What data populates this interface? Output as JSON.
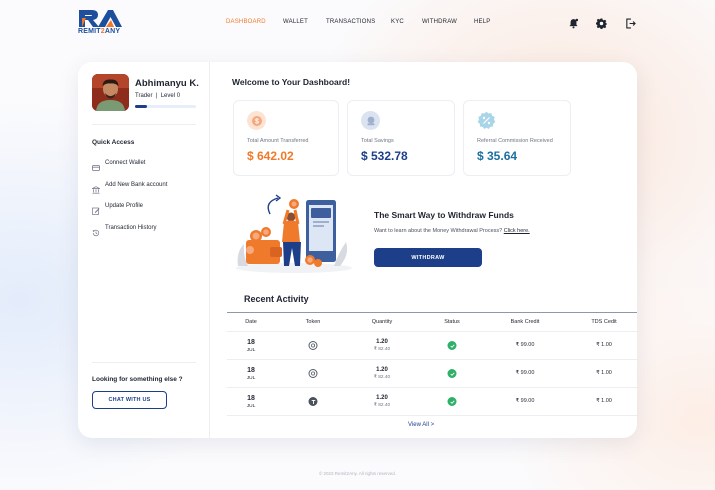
{
  "brand": {
    "logo_text_a": "REMIT",
    "logo_text_b": "2",
    "logo_text_c": "ANY",
    "logo_icon": "ra-logo-icon"
  },
  "nav": {
    "items": [
      {
        "label": "DASHBOARD",
        "active": true
      },
      {
        "label": "WALLET",
        "active": false
      },
      {
        "label": "TRANSACTIONS",
        "active": false
      },
      {
        "label": "KYC",
        "active": false
      },
      {
        "label": "WITHDRAW",
        "active": false
      },
      {
        "label": "HELP",
        "active": false
      }
    ],
    "icons": [
      "bell-icon",
      "gear-icon",
      "logout-icon"
    ]
  },
  "profile": {
    "name": "Abhimanyu K.",
    "role": "Trader",
    "level": "Level 0",
    "level_progress": 0.2
  },
  "quick_access": {
    "title": "Quick Access",
    "items": [
      {
        "label": "Connect Wallet",
        "icon": "wallet-icon"
      },
      {
        "label": "Add New Bank account",
        "icon": "bank-icon"
      },
      {
        "label": "Update Profile",
        "icon": "edit-icon"
      },
      {
        "label": "Transaction History",
        "icon": "history-icon"
      }
    ]
  },
  "help": {
    "title": "Looking for something else ?",
    "button": "CHAT WITH US"
  },
  "welcome": "Welcome to Your Dashboard!",
  "stats": [
    {
      "label": "Total Amount Transferred",
      "value": "$ 642.02",
      "color": "#f07a2b",
      "icon": "dollar-coin-icon"
    },
    {
      "label": "Total Savings",
      "value": "$ 532.78",
      "color": "#1d3f8a",
      "icon": "savings-icon"
    },
    {
      "label": "Referral Commission Received",
      "value": "$ 35.64",
      "color": "#1d6fa0",
      "icon": "percent-badge-icon"
    }
  ],
  "promo": {
    "title": "The Smart Way to Withdraw Funds",
    "text": "Want to learn about the Money Withdrawal Process?",
    "link": "Click here.",
    "button": "WITHDRAW"
  },
  "recent": {
    "title": "Recent Activity",
    "columns": [
      "Date",
      "Token",
      "Quantity",
      "Status",
      "Bank Credit",
      "TDS Cedit"
    ],
    "rows": [
      {
        "day": "18",
        "month": "JUL",
        "token": "token-coin-icon",
        "qty": "1.20",
        "qty_sub": "₹ 82.40",
        "status": "success-check-icon",
        "bank_credit": "₹ 99.00",
        "tds": "₹ 1.00"
      },
      {
        "day": "18",
        "month": "JUL",
        "token": "token-coin-icon",
        "qty": "1.20",
        "qty_sub": "₹ 82.40",
        "status": "success-check-icon",
        "bank_credit": "₹ 99.00",
        "tds": "₹ 1.00"
      },
      {
        "day": "18",
        "month": "JUL",
        "token": "tether-icon",
        "qty": "1.20",
        "qty_sub": "₹ 82.40",
        "status": "success-check-icon",
        "bank_credit": "₹ 99.00",
        "tds": "₹ 1.00"
      }
    ],
    "view_all": "View All  >"
  },
  "footer": "© 2023 Remit2Any. All rights reserved."
}
